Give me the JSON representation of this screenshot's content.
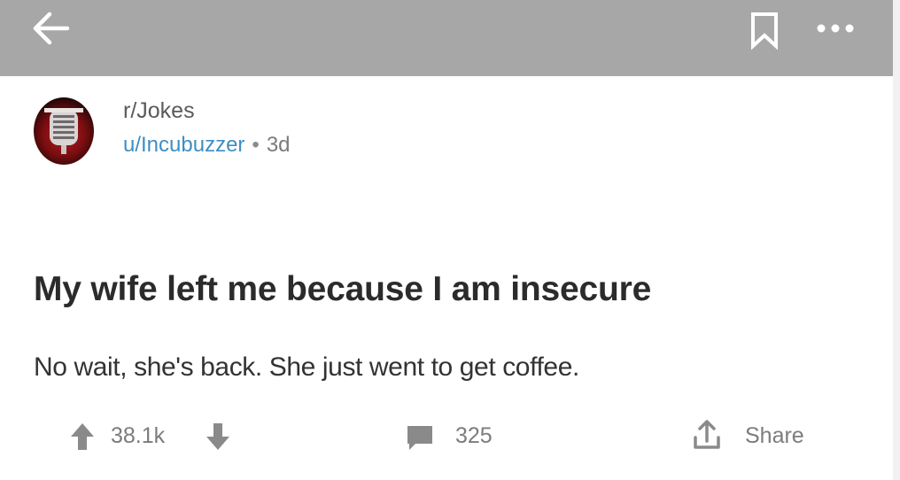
{
  "topbar": {
    "background": "#a7a7a7",
    "back_icon": "arrow-left-icon",
    "bookmark_icon": "bookmark-icon",
    "more_icon": "more-horizontal-icon"
  },
  "post": {
    "subreddit": "r/Jokes",
    "author": "u/Incubuzzer",
    "separator": "•",
    "age": "3d",
    "title": "My wife left me because I am insecure",
    "body": "No wait, she's back. She just went to get coffee."
  },
  "actions": {
    "score": "38.1k",
    "comment_count": "325",
    "share_label": "Share",
    "upvote_icon": "upvote-arrow-icon",
    "downvote_icon": "downvote-arrow-icon",
    "comment_icon": "comment-bubble-icon",
    "share_icon": "share-upload-icon"
  },
  "colors": {
    "author_link": "#3f8ec3",
    "title_text": "#2b2b2b",
    "muted_text": "#7c7c7c"
  }
}
